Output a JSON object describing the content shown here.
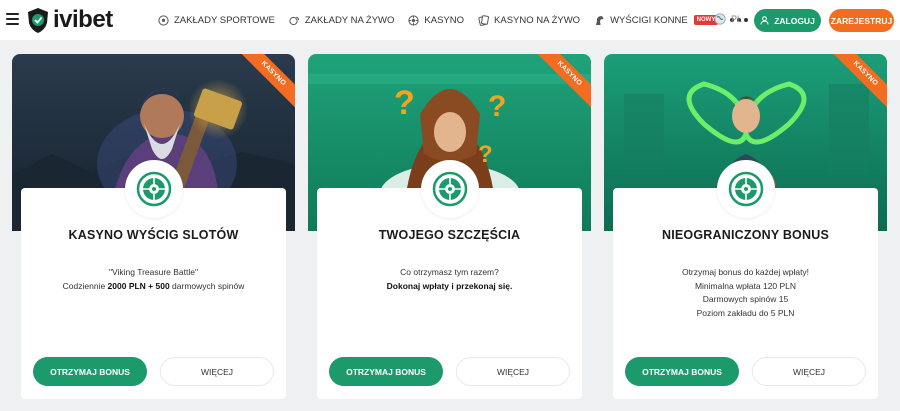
{
  "header": {
    "logo_text": "ivibet",
    "nav": [
      {
        "label": "ZAKŁADY SPORTOWE",
        "icon": "soccer-ball-icon"
      },
      {
        "label": "ZAKŁADY NA ŻYWO",
        "icon": "live-sports-icon"
      },
      {
        "label": "KASYNO",
        "icon": "roulette-icon"
      },
      {
        "label": "KASYNO NA ŻYWO",
        "icon": "live-casino-icon"
      },
      {
        "label": "WYŚCIGI KONNE",
        "icon": "horse-icon",
        "badge": "NOWY"
      }
    ],
    "language": "PL",
    "login_label": "ZALOGUJ",
    "register_label": "ZAREJESTRUJ"
  },
  "cards": [
    {
      "ribbon": "KASYNO",
      "title": "KASYNO WYŚCIG SLOTÓW",
      "line1": "\"Viking Treasure Battle\"",
      "line2_pre": "Codziennie ",
      "line2_bold": "2000 PLN + 500",
      "line2_post": " darmowych spinów",
      "bonus_label": "OTRZYMAJ BONUS",
      "more_label": "WIĘCEJ"
    },
    {
      "ribbon": "KASYNO",
      "title": "TWOJEGO SZCZĘŚCIA",
      "line1": "Co otrzymasz tym razem?",
      "line2_bold": "Dokonaj wpłaty i przekonaj się.",
      "bonus_label": "OTRZYMAJ BONUS",
      "more_label": "WIĘCEJ"
    },
    {
      "ribbon": "KASYNO",
      "title": "NIEOGRANICZONY BONUS",
      "line1": "Otrzymaj bonus do każdej wpłaty!",
      "line2": "Minimalna wpłata 120 PLN",
      "line3": "Darmowych spinów 15",
      "line4": "Poziom zakładu do 5 PLN",
      "bonus_label": "OTRZYMAJ BONUS",
      "more_label": "WIĘCEJ"
    }
  ],
  "colors": {
    "brand_green": "#1d9a6c",
    "brand_orange": "#f26c21",
    "badge_red": "#e53935",
    "page_bg": "#eef0f2"
  }
}
